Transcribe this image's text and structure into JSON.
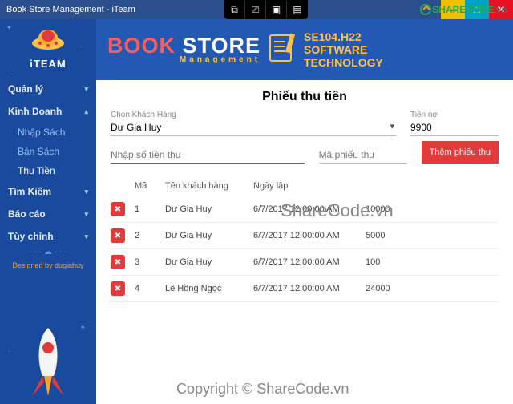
{
  "window": {
    "title": "Book Store Management - iTeam"
  },
  "toolbar": {
    "icons": [
      "screen-icon",
      "cast-icon",
      "layout-icon",
      "qr-icon"
    ]
  },
  "sharecode": {
    "brand": "SHARECODE",
    "tld": ".vn"
  },
  "sidebar": {
    "logo_name": "iTEAM",
    "items": [
      {
        "label": "Quản lý",
        "expandable": true
      },
      {
        "label": "Kinh Doanh",
        "expandable": true,
        "open": true,
        "children": [
          {
            "label": "Nhập Sách"
          },
          {
            "label": "Bán Sách"
          },
          {
            "label": "Thu Tiền",
            "active": true
          }
        ]
      },
      {
        "label": "Tìm Kiếm",
        "expandable": true
      },
      {
        "label": "Báo cáo",
        "expandable": true
      },
      {
        "label": "Tùy chỉnh",
        "expandable": true
      }
    ],
    "designed_label": "Designed by dugiahuy"
  },
  "banner": {
    "title_a": "BOOK",
    "title_b": "STORE",
    "subtitle": "Management",
    "right1": "SE104.H22",
    "right2": "SOFTWARE",
    "right3": "TECHNOLOGY"
  },
  "form": {
    "page_title": "Phiếu thu tiền",
    "customer_label": "Chọn Khách Hàng",
    "customer_value": "Dư Gia Huy",
    "debt_label": "Tiền nợ",
    "debt_value": "9900",
    "amount_placeholder": "Nhập số tiền thu",
    "code_placeholder": "Mã phiếu thu",
    "submit_label": "Thêm phiếu thu"
  },
  "table": {
    "headers": {
      "id": "Mã",
      "name": "Tên khách hàng",
      "date": "Ngày lập",
      "amount": ""
    },
    "rows": [
      {
        "id": "1",
        "name": "Dư Gia Huy",
        "date": "6/7/2017 12:00:00 AM",
        "amount": "10000"
      },
      {
        "id": "2",
        "name": "Dư Gia Huy",
        "date": "6/7/2017 12:00:00 AM",
        "amount": "5000"
      },
      {
        "id": "3",
        "name": "Dư Gia Huy",
        "date": "6/7/2017 12:00:00 AM",
        "amount": "100"
      },
      {
        "id": "4",
        "name": "Lê Hồng Ngọc",
        "date": "6/7/2017 12:00:00 AM",
        "amount": "24000"
      }
    ]
  },
  "watermarks": {
    "center": "ShareCode.vn",
    "bottom": "Copyright © ShareCode.vn"
  }
}
